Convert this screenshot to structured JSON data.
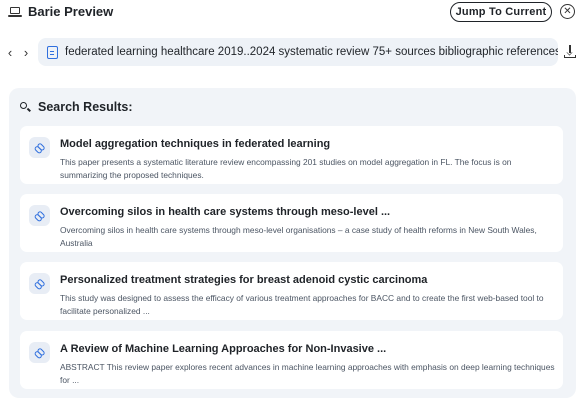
{
  "app": {
    "title": "Barie Preview",
    "jump_label": "Jump To Current",
    "close_icon": "close-icon"
  },
  "nav": {
    "back_icon": "chevron-left-icon",
    "forward_icon": "chevron-right-icon",
    "url": "federated learning healthcare 2019..2024 systematic review 75+ sources bibliographic references",
    "download_icon": "download-icon"
  },
  "results": {
    "title": "Search Results:",
    "items": [
      {
        "title": "Model aggregation techniques in federated learning",
        "description": "This paper presents a systematic literature review encompassing 201 studies on model aggregation in FL. The focus is on summarizing the proposed techniques."
      },
      {
        "title": "Overcoming silos in health care systems through meso-level ...",
        "description": "Overcoming silos in health care systems through meso-level organisations – a case study of health reforms in New South Wales, Australia"
      },
      {
        "title": "Personalized treatment strategies for breast adenoid cystic carcinoma",
        "description": "This study was designed to assess the efficacy of various treatment approaches for BACC and to create the first web-based tool to facilitate personalized ..."
      },
      {
        "title": "A Review of Machine Learning Approaches for Non-Invasive ...",
        "description": "ABSTRACT This review paper explores recent advances in machine learning approaches with emphasis on deep learning techniques for ..."
      }
    ]
  }
}
